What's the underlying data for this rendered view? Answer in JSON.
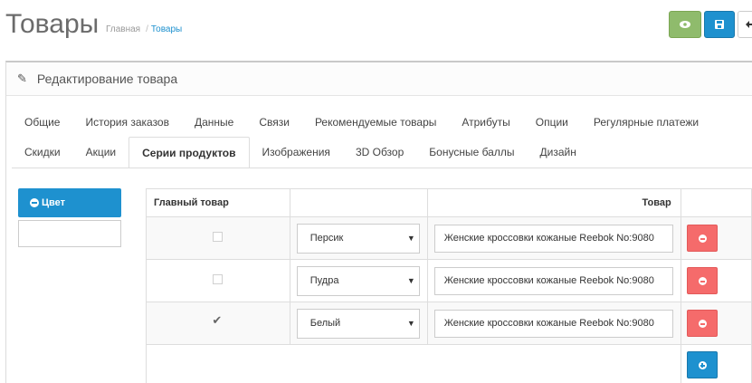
{
  "page": {
    "title": "Товары",
    "breadcrumb": {
      "home": "Главная",
      "separator": "/",
      "current": "Товары"
    }
  },
  "panel": {
    "heading": "Редактирование товара"
  },
  "tabs": {
    "row1": [
      "Общие",
      "История заказов",
      "Данные",
      "Связи",
      "Рекомендуемые товары",
      "Атрибуты",
      "Опции",
      "Регулярные платежи"
    ],
    "row2": [
      "Скидки",
      "Акции",
      "Серии продуктов",
      "Изображения",
      "3D Обзор",
      "Бонусные баллы",
      "Дизайн"
    ],
    "active": "Серии продуктов"
  },
  "sidebar": {
    "color_button_label": "Цвет",
    "color_input_value": ""
  },
  "table": {
    "headers": [
      "Главный товар",
      "",
      "Товар",
      ""
    ],
    "rows": [
      {
        "main": false,
        "color": "Персик",
        "product": "Женские кроссовки кожаные Reebok No:9080"
      },
      {
        "main": false,
        "color": "Пудра",
        "product": "Женские кроссовки кожаные Reebok No:9080"
      },
      {
        "main": true,
        "color": "Белый",
        "product": "Женские кроссовки кожаные Reebok No:9080"
      }
    ]
  },
  "icons": {
    "view": "eye-icon",
    "save": "save-icon",
    "back": "back-arrow-icon",
    "edit": "pencil-icon",
    "remove": "minus-circle-icon",
    "add": "plus-circle-icon"
  },
  "colors": {
    "primary": "#1e91cf",
    "success": "#8fbb6c",
    "danger": "#f56b6b"
  }
}
